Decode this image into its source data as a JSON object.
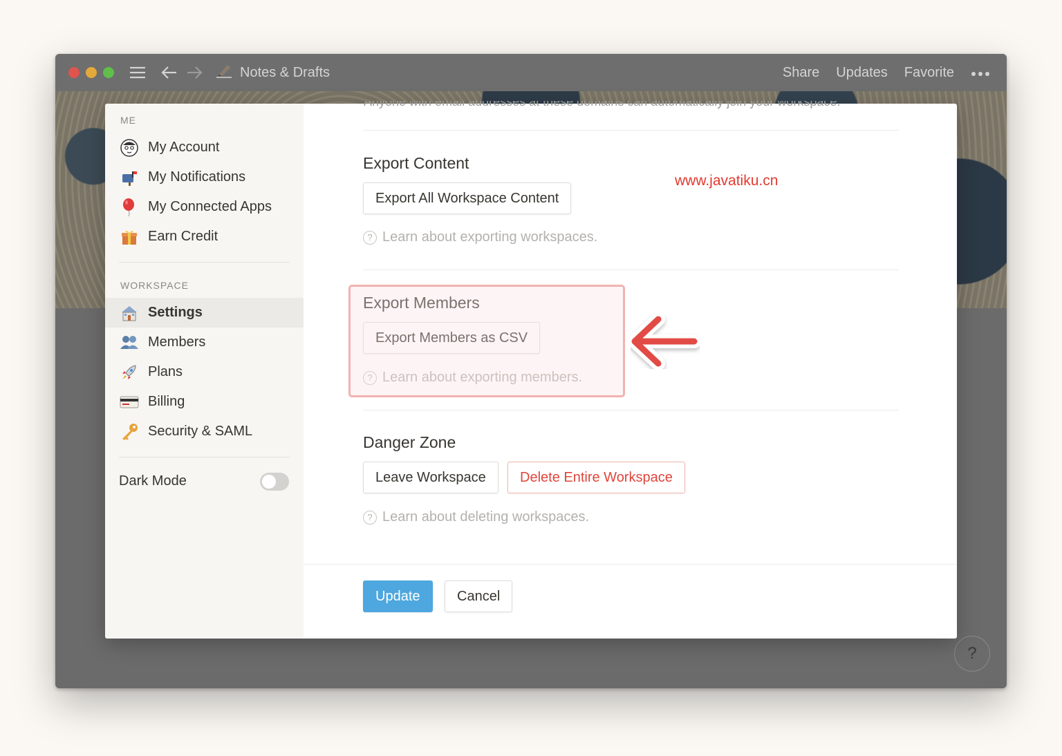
{
  "window": {
    "title": "Notes & Drafts",
    "actions": [
      "Share",
      "Updates",
      "Favorite"
    ],
    "more_icon": "ellipsis-icon"
  },
  "sidebar": {
    "me_heading": "ME",
    "me_items": [
      {
        "label": "My Account",
        "icon": "avatar-icon"
      },
      {
        "label": "My Notifications",
        "icon": "mailbox-icon"
      },
      {
        "label": "My Connected Apps",
        "icon": "balloon-icon"
      },
      {
        "label": "Earn Credit",
        "icon": "gift-icon"
      }
    ],
    "workspace_heading": "WORKSPACE",
    "workspace_items": [
      {
        "label": "Settings",
        "icon": "house-icon",
        "active": true
      },
      {
        "label": "Members",
        "icon": "people-icon"
      },
      {
        "label": "Plans",
        "icon": "rocket-icon"
      },
      {
        "label": "Billing",
        "icon": "credit-card-icon"
      },
      {
        "label": "Security & SAML",
        "icon": "key-icon"
      }
    ],
    "dark_mode_label": "Dark Mode",
    "dark_mode_on": false
  },
  "main": {
    "cut_off_text": "Anyone with email addresses at these domains can automatically join your workspace.",
    "export_content": {
      "heading": "Export Content",
      "button": "Export All Workspace Content",
      "help": "Learn about exporting workspaces."
    },
    "export_members": {
      "heading": "Export Members",
      "button": "Export Members as CSV",
      "help": "Learn about exporting members."
    },
    "danger_zone": {
      "heading": "Danger Zone",
      "leave_button": "Leave Workspace",
      "delete_button": "Delete Entire Workspace",
      "help": "Learn about deleting workspaces."
    },
    "footer": {
      "update_button": "Update",
      "cancel_button": "Cancel"
    }
  },
  "watermark": "www.javatiku.cn",
  "help_button": "?",
  "colors": {
    "accent_blue": "#4ea7de",
    "danger_red": "#e0443a",
    "highlight_pink": "#f2b2b0",
    "arrow_red": "#e24b44"
  }
}
